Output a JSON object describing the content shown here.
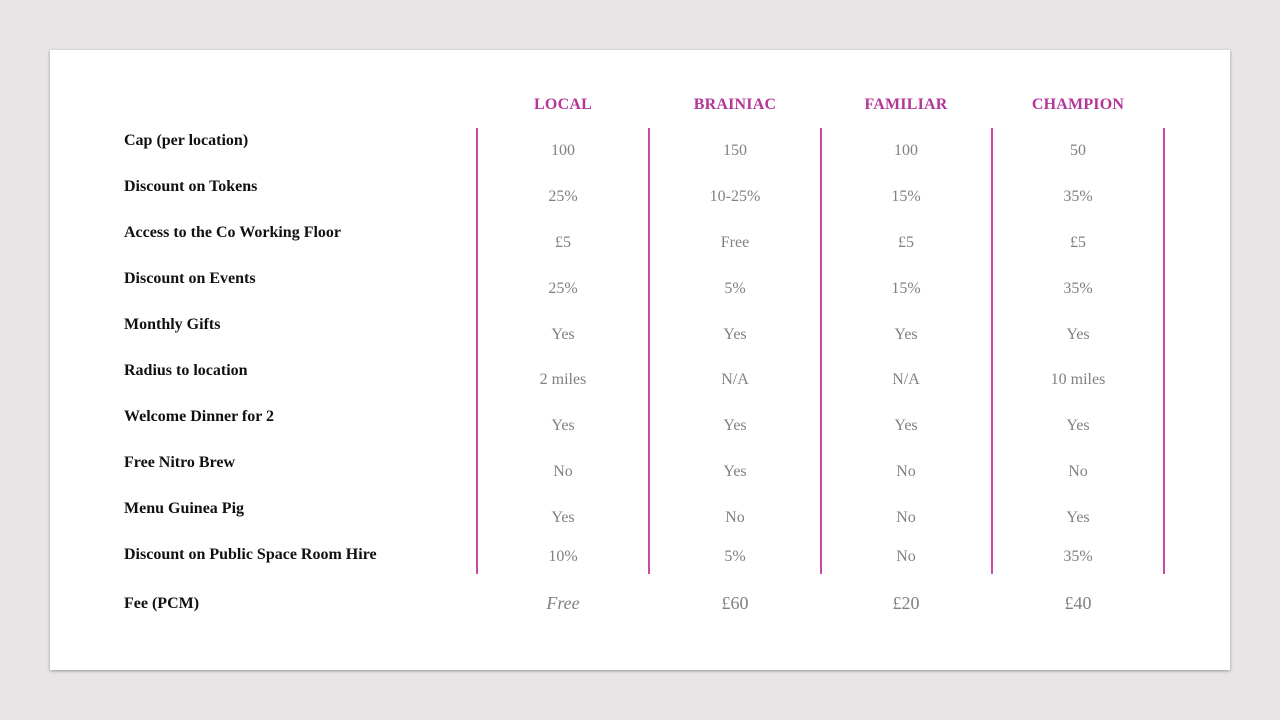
{
  "table": {
    "columns": [
      "LOCAL",
      "BRAINIAC",
      "FAMILIAR",
      "CHAMPION"
    ],
    "rows": [
      {
        "label": "Cap (per location)",
        "values": [
          "100",
          "150",
          "100",
          "50"
        ]
      },
      {
        "label": "Discount on Tokens",
        "values": [
          "25%",
          "10-25%",
          "15%",
          "35%"
        ]
      },
      {
        "label": "Access to the Co Working Floor",
        "values": [
          "£5",
          "Free",
          "£5",
          "£5"
        ]
      },
      {
        "label": "Discount on Events",
        "values": [
          "25%",
          "5%",
          "15%",
          "35%"
        ]
      },
      {
        "label": "Monthly Gifts",
        "values": [
          "Yes",
          "Yes",
          "Yes",
          "Yes"
        ]
      },
      {
        "label": "Radius to location",
        "values": [
          "2 miles",
          "N/A",
          "N/A",
          "10 miles"
        ]
      },
      {
        "label": "Welcome Dinner for 2",
        "values": [
          "Yes",
          "Yes",
          "Yes",
          "Yes"
        ]
      },
      {
        "label": "Free Nitro Brew",
        "values": [
          "No",
          "Yes",
          "No",
          "No"
        ]
      },
      {
        "label": "Menu Guinea Pig",
        "values": [
          "Yes",
          "No",
          "No",
          "Yes"
        ]
      },
      {
        "label": "Discount on Public Space Room Hire",
        "values": [
          "10%",
          "5%",
          "No",
          "35%"
        ]
      }
    ],
    "fee": {
      "label": "Fee (PCM)",
      "values": [
        "Free",
        "£60",
        "£20",
        "£40"
      ]
    }
  },
  "colors": {
    "accent": "#b5369b",
    "divider": "#c849a9",
    "value_text": "#808080",
    "label_text": "#111111",
    "page_bg": "#e6e4e5"
  }
}
